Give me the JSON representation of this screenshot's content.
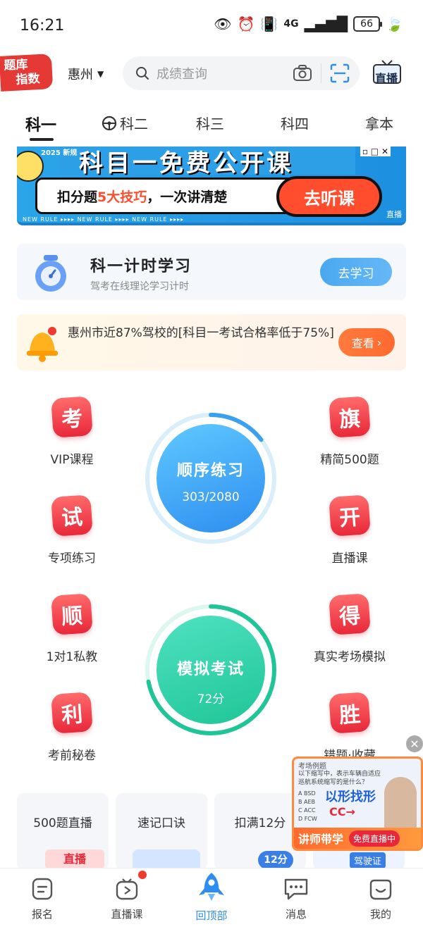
{
  "status": {
    "time": "16:21",
    "network": "4G",
    "battery": "66"
  },
  "header": {
    "logo_line1": "题库",
    "logo_line2": "指数",
    "city": "惠州",
    "search_placeholder": "成绩查询",
    "live_label": "直播"
  },
  "tabs": [
    {
      "label": "科一",
      "active": true
    },
    {
      "label": "科二",
      "active": false
    },
    {
      "label": "科三",
      "active": false
    },
    {
      "label": "科四",
      "active": false
    },
    {
      "label": "拿本",
      "active": false
    }
  ],
  "banner": {
    "year_tag": "2025 新规",
    "title": "科目一免费公开课",
    "subtitle_pre": "扣分题",
    "subtitle_hl": "5大技巧",
    "subtitle_post": "，一次讲清楚",
    "button": "去听课",
    "rule_text": "NEW RULE ▸▸▸▸ NEW RULE ▸▸▸▸ NEW RULE ▸▸▸▸",
    "ad_tag": "直播"
  },
  "study": {
    "title": "科一计时学习",
    "subtitle": "驾考在线理论学习计时",
    "button": "去学习"
  },
  "notice": {
    "text": "惠州市近87%驾校的[科目一考试合格率低于75%]",
    "button": "查看"
  },
  "features_left": [
    {
      "badge": "考",
      "label": "VIP课程"
    },
    {
      "badge": "试",
      "label": "专项练习"
    },
    {
      "badge": "顺",
      "label": "1对1私教"
    },
    {
      "badge": "利",
      "label": "考前秘卷"
    }
  ],
  "features_right": [
    {
      "badge": "旗",
      "label": "精简500题"
    },
    {
      "badge": "开",
      "label": "直播课"
    },
    {
      "badge": "得",
      "label": "真实考场模拟"
    },
    {
      "badge": "胜",
      "label": "错题·收藏"
    }
  ],
  "practice": {
    "title": "顺序练习",
    "progress_text": "303/2080",
    "progress": 0.146
  },
  "exam": {
    "title": "模拟考试",
    "score_text": "72分",
    "progress": 0.72
  },
  "cards": [
    {
      "label": "500题直播",
      "tag": "直播"
    },
    {
      "label": "速记口诀"
    },
    {
      "label": "扣满12分",
      "tag": "12分"
    },
    {
      "label": "驾驶证"
    }
  ],
  "float_video": {
    "header": "考场例题",
    "question": "以下缩写中，表示车辆自适应巡航系统缩写的是什么？",
    "options": [
      "A BSD",
      "B AEB",
      "C ACC",
      "D FCW"
    ],
    "big": "以形找形",
    "cc": "CC→",
    "bar_left": "讲师带学",
    "bar_right": "免费直播中",
    "close": "✕"
  },
  "nav": [
    {
      "label": "报名",
      "icon": "signup-icon"
    },
    {
      "label": "直播课",
      "icon": "tv-icon"
    },
    {
      "label": "回顶部",
      "icon": "rocket-icon",
      "active": true
    },
    {
      "label": "消息",
      "icon": "message-icon"
    },
    {
      "label": "我的",
      "icon": "profile-icon"
    }
  ],
  "colors": {
    "accent": "#2e8df0",
    "red": "#e8283a",
    "green": "#1fc596",
    "orange": "#ff6a2f"
  }
}
